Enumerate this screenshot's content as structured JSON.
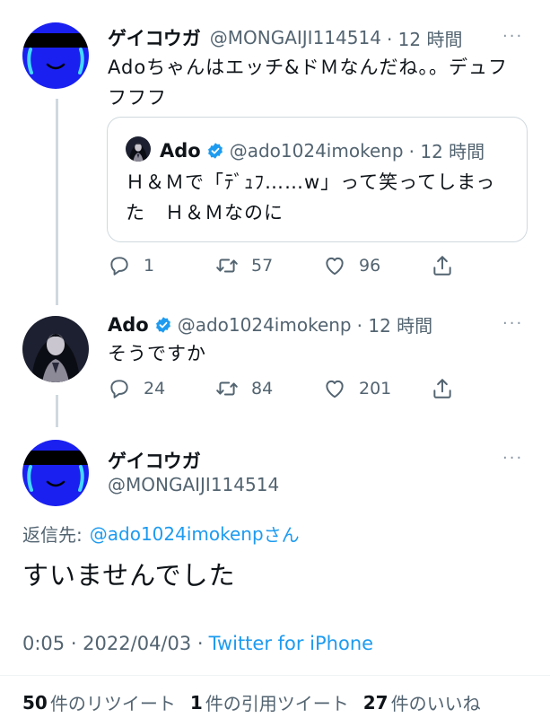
{
  "tweet1": {
    "display_name": "ゲイコウガ",
    "handle": "@MONGAIJI114514",
    "time": "· 12 時間",
    "text_line1": "Adoちゃんはエッチ&ドＭなんだね。。デュフ",
    "text_line2": "フフフ",
    "quote": {
      "display_name": "Ado",
      "handle": "@ado1024imokenp",
      "time": "· 12 時間",
      "text_line1": "Ｈ＆Ｍで「ﾃﾞｭﾌ……w」って笑ってしまっ",
      "text_line2": "た　Ｈ＆Ｍなのに"
    },
    "replies": "1",
    "retweets": "57",
    "likes": "96"
  },
  "tweet2": {
    "display_name": "Ado",
    "handle": "@ado1024imokenp",
    "time": "· 12 時間",
    "text": "そうですか",
    "replies": "24",
    "retweets": "84",
    "likes": "201"
  },
  "main_tweet": {
    "display_name": "ゲイコウガ",
    "handle": "@MONGAIJI114514",
    "reply_to_label": "返信先:",
    "reply_to_handle": "@ado1024imokenp",
    "reply_to_suffix": "さん",
    "text": "すいませんでした",
    "timestamp": "0:05 · 2022/04/03 ·",
    "source": "Twitter for iPhone",
    "stats": {
      "retweets_count": "50",
      "retweets_label": "件のリツイート",
      "quotes_count": "1",
      "quotes_label": "件の引用ツイート",
      "likes_count": "27",
      "likes_label": "件のいいね"
    }
  },
  "more_glyph": "···",
  "colors": {
    "link_blue": "#1d9bf0",
    "verified_blue": "#1d9bf0",
    "secondary_text": "#536471",
    "avatar_blue": "#1a20f0",
    "thread_line": "#cfd9de"
  },
  "icons": [
    "reply-icon",
    "retweet-icon",
    "like-icon",
    "share-icon",
    "verified-icon",
    "more-icon"
  ]
}
